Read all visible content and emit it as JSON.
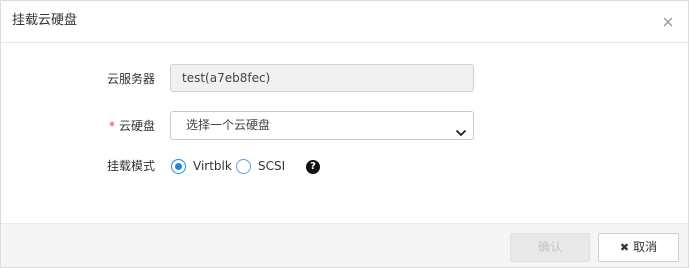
{
  "dialog": {
    "title": "挂载云硬盘",
    "close_icon": "close-icon"
  },
  "form": {
    "server": {
      "label": "云服务器",
      "value": "test(a7eb8fec)"
    },
    "disk": {
      "required_mark": "*",
      "label": "云硬盘",
      "placeholder": "选择一个云硬盘"
    },
    "mode": {
      "label": "挂载模式",
      "options": [
        {
          "label": "Virtblk",
          "checked": true
        },
        {
          "label": "SCSI",
          "checked": false
        }
      ],
      "help_icon": "question-circle-icon",
      "help_glyph": "?"
    }
  },
  "footer": {
    "confirm_label": "确认",
    "cancel_label": "取消",
    "cancel_icon_glyph": "✖"
  },
  "colors": {
    "accent": "#1e88e5",
    "required": "#e4393c"
  }
}
